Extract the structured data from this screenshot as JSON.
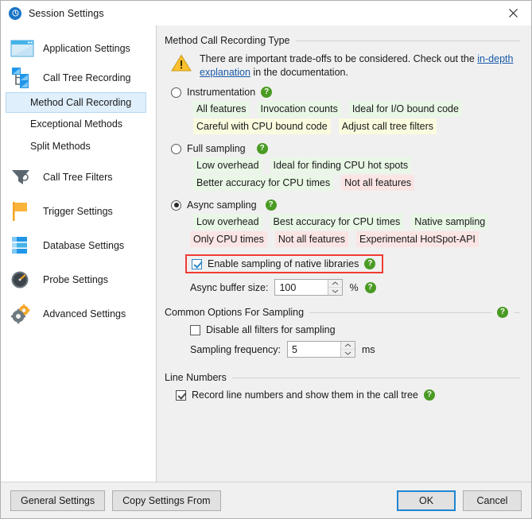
{
  "window": {
    "title": "Session Settings",
    "title_icon": "info-circle-icon",
    "close_icon": "close-icon"
  },
  "sidebar": {
    "items": [
      {
        "label": "Application Settings",
        "icon": "application-window-icon",
        "selected": false,
        "sub": false
      },
      {
        "label": "Call Tree Recording",
        "icon": "call-tree-icon",
        "selected": false,
        "sub": false
      },
      {
        "label": "Method Call Recording",
        "icon": "",
        "selected": true,
        "sub": true
      },
      {
        "label": "Exceptional Methods",
        "icon": "",
        "selected": false,
        "sub": true
      },
      {
        "label": "Split Methods",
        "icon": "",
        "selected": false,
        "sub": true
      },
      {
        "label": "Call Tree Filters",
        "icon": "funnel-icon",
        "selected": false,
        "sub": false
      },
      {
        "label": "Trigger Settings",
        "icon": "flag-icon",
        "selected": false,
        "sub": false
      },
      {
        "label": "Database Settings",
        "icon": "database-icon",
        "selected": false,
        "sub": false
      },
      {
        "label": "Probe Settings",
        "icon": "gauge-icon",
        "selected": false,
        "sub": false
      },
      {
        "label": "Advanced Settings",
        "icon": "gears-icon",
        "selected": false,
        "sub": false
      }
    ]
  },
  "main": {
    "recording_group": {
      "title": "Method Call Recording Type",
      "warning_icon": "warning-triangle-icon",
      "warning_text_1": "There are important trade-offs to be considered. Check out the ",
      "warning_link": "in-depth explanation",
      "warning_text_2": " in the documentation."
    },
    "options": [
      {
        "label": "Instrumentation",
        "selected": false,
        "help_icon": "help-icon",
        "tags": [
          {
            "text": "All features",
            "tone": "green"
          },
          {
            "text": "Invocation counts",
            "tone": "green"
          },
          {
            "text": "Ideal for I/O bound code",
            "tone": "green"
          },
          {
            "text": "Careful with CPU bound code",
            "tone": "yellow"
          },
          {
            "text": "Adjust call tree filters",
            "tone": "yellow"
          }
        ]
      },
      {
        "label": "Full sampling",
        "selected": false,
        "help_icon": "help-icon",
        "tags": [
          {
            "text": "Low overhead",
            "tone": "green"
          },
          {
            "text": "Ideal for finding CPU hot spots",
            "tone": "green"
          },
          {
            "text": "Better accuracy for CPU times",
            "tone": "green"
          },
          {
            "text": "Not all features",
            "tone": "red"
          }
        ]
      },
      {
        "label": "Async sampling",
        "selected": true,
        "help_icon": "help-icon",
        "tags": [
          {
            "text": "Low overhead",
            "tone": "green"
          },
          {
            "text": "Best accuracy for CPU times",
            "tone": "green"
          },
          {
            "text": "Native sampling",
            "tone": "green"
          },
          {
            "text": "Only CPU times",
            "tone": "red"
          },
          {
            "text": "Not all features",
            "tone": "red"
          },
          {
            "text": "Experimental HotSpot-API",
            "tone": "red"
          }
        ]
      }
    ],
    "native_libs": {
      "label": "Enable sampling of native libraries",
      "checked": true,
      "help_icon": "help-icon",
      "highlight_color": "#f03b32"
    },
    "async_buffer": {
      "label": "Async buffer size:",
      "value": "100",
      "unit": "%",
      "help_icon": "help-icon"
    },
    "common_group": {
      "title": "Common Options For Sampling",
      "help_icon": "help-icon",
      "disable_filters": {
        "label": "Disable all filters for sampling",
        "checked": false
      },
      "sampling_frequency": {
        "label": "Sampling frequency:",
        "value": "5",
        "unit": "ms"
      }
    },
    "line_numbers_group": {
      "title": "Line Numbers",
      "record_line_numbers": {
        "label": "Record line numbers and show them in the call tree",
        "checked": true,
        "help_icon": "help-icon"
      }
    }
  },
  "footer": {
    "general_settings": "General Settings",
    "copy_settings_from": "Copy Settings From",
    "ok": "OK",
    "cancel": "Cancel"
  }
}
